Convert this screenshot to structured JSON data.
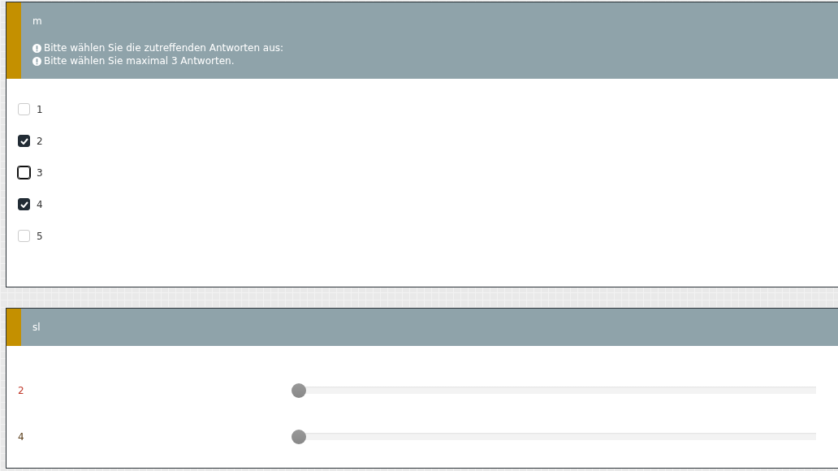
{
  "questions": [
    {
      "kind": "multi",
      "title": "m",
      "hints": [
        "Bitte wählen Sie die zutreffenden Antworten aus:",
        "Bitte wählen Sie maximal 3 Antworten."
      ],
      "options": [
        {
          "label": "1",
          "checked": false,
          "focused": false
        },
        {
          "label": "2",
          "checked": true,
          "focused": false
        },
        {
          "label": "3",
          "checked": false,
          "focused": true
        },
        {
          "label": "4",
          "checked": true,
          "focused": false
        },
        {
          "label": "5",
          "checked": false,
          "focused": false
        }
      ]
    },
    {
      "kind": "slider",
      "title": "sl",
      "sliders": [
        {
          "label": "2",
          "color": "#c0392b",
          "level": 0
        },
        {
          "label": "4",
          "color": "#5a3e1b",
          "level": 0
        }
      ]
    }
  ]
}
